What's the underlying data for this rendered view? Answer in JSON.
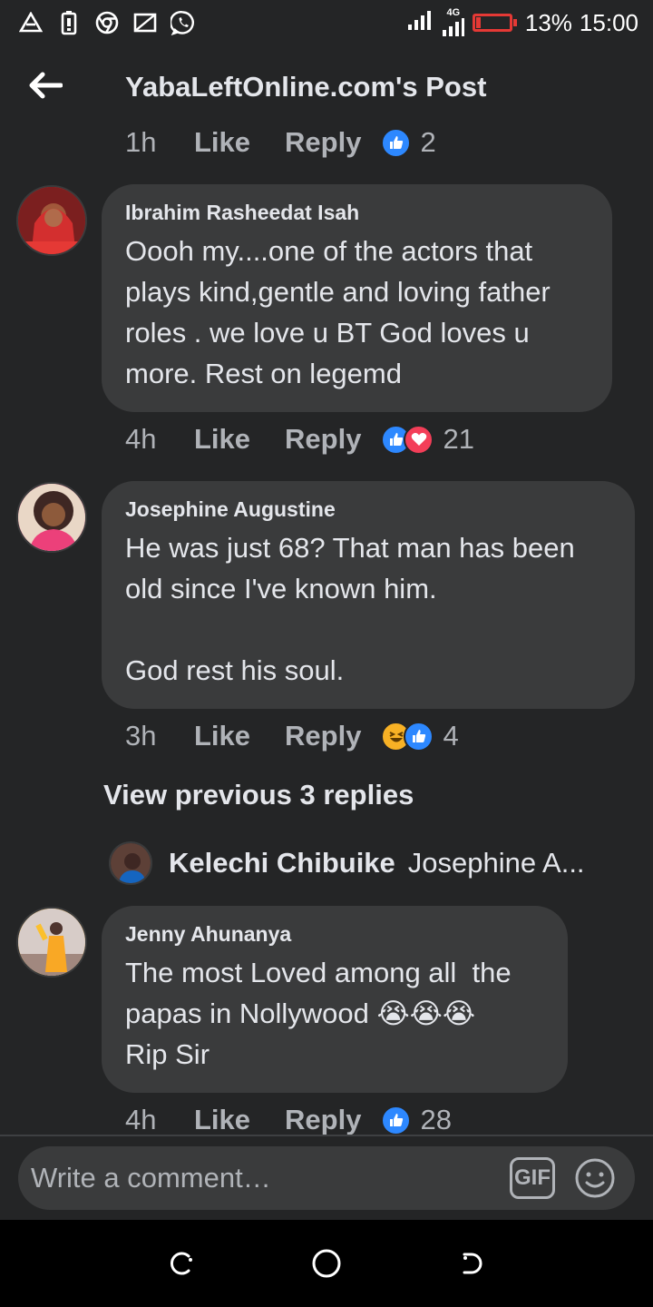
{
  "status_bar": {
    "network": "4G",
    "battery_percent": "13%",
    "battery_level": 0.13,
    "time": "15:00",
    "icons": [
      "drive-icon",
      "battery-saver-icon",
      "chrome-icon",
      "cast-icon",
      "whatsapp-icon"
    ]
  },
  "header": {
    "title": "YabaLeftOnline.com's Post",
    "back_icon": "arrow-left-icon"
  },
  "top_actions": {
    "time": "1h",
    "like_label": "Like",
    "reply_label": "Reply",
    "reactions": [
      "like"
    ],
    "count": "2"
  },
  "comments": [
    {
      "author": "Ibrahim Rasheedat Isah",
      "text": "Oooh my....one of the actors that plays kind,gentle and loving father roles . we love u BT God loves u more. Rest on legemd",
      "time": "4h",
      "like_label": "Like",
      "reply_label": "Reply",
      "reactions": [
        "like",
        "love"
      ],
      "count": "21",
      "avatar_color": "#c62828"
    },
    {
      "author": "Josephine Augustine",
      "text": "He was just 68? That man has been old since I've known him.\n\nGod rest his soul.",
      "time": "3h",
      "like_label": "Like",
      "reply_label": "Reply",
      "reactions": [
        "haha",
        "like"
      ],
      "count": "4",
      "avatar_color": "#ec407a"
    },
    {
      "author": "Jenny Ahunanya",
      "text": "The most Loved among all  the papas in Nollywood 😭😭😭\nRip Sir",
      "time": "4h",
      "like_label": "Like",
      "reply_label": "Reply",
      "reactions": [
        "like"
      ],
      "count": "28",
      "avatar_color": "#f9a825"
    }
  ],
  "replies": {
    "view_previous": "View previous 3 replies",
    "preview_author": "Kelechi Chibuike",
    "preview_snippet": "Josephine A..."
  },
  "composer": {
    "placeholder": "Write a comment…",
    "gif_label": "GIF",
    "emoji_icon": "smiley-icon"
  },
  "navbar": {
    "icons": [
      "recent-apps-icon",
      "home-icon",
      "back-icon"
    ]
  },
  "colors": {
    "background": "#242526",
    "bubble": "#3a3b3c",
    "like_blue": "#2d88ff",
    "love_red": "#f33e58",
    "battery_red": "#e53935"
  }
}
